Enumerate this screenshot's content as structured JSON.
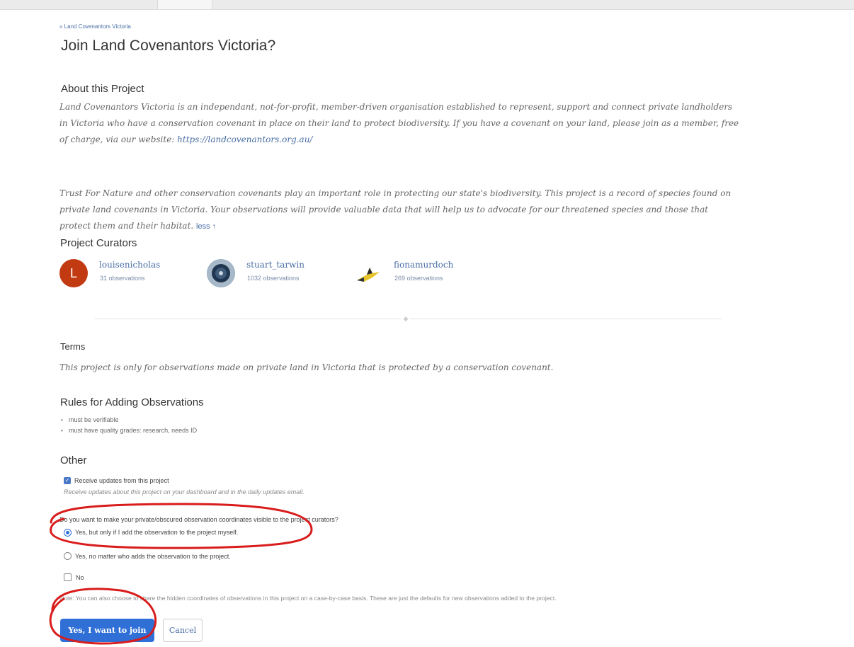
{
  "breadcrumb": "« Land Covenantors Victoria",
  "page_title": "Join Land Covenantors Victoria?",
  "about": {
    "heading": "About this Project",
    "para1": "Land Covenantors Victoria is an independant, not-for-profit, member-driven organisation established to represent, support and connect private landholders in Victoria who have a conservation covenant in place on their land to protect biodiversity. If you have a covenant on your land, please join as a member, free of charge, via our website: ",
    "para1_link": "https://landcovenantors.org.au/",
    "para2": "Trust For Nature and other conservation covenants play an important role in protecting our state's biodiversity. This project is a record of species found on private land covenants in Victoria. Your observations will provide valuable data that will help us to advocate for our threatened species and those that protect them and their habitat. ",
    "less_link": "less ↑"
  },
  "curators": {
    "heading": "Project Curators",
    "items": [
      {
        "name": "louisenicholas",
        "obs": "31 observations",
        "initial": "L",
        "color": "#c23a12"
      },
      {
        "name": "stuart_tarwin",
        "obs": "1032 observations",
        "color": "#2b4a6b"
      },
      {
        "name": "fionamurdoch",
        "obs": "269 observations",
        "color": "#e6c32a"
      }
    ]
  },
  "terms": {
    "heading": "Terms",
    "text": "This project is only for observations made on private land in Victoria that is protected by a conservation covenant."
  },
  "rules": {
    "heading": "Rules for Adding Observations",
    "items": [
      "must be verifiable",
      "must have quality grades: research, needs ID"
    ]
  },
  "other": {
    "heading": "Other",
    "receive_updates_label": "Receive updates from this project",
    "receive_updates_checked": true,
    "receive_updates_hint": "Receive updates about this project on your dashboard and in the daily updates email.",
    "question": "Do you want to make your private/obscured observation coordinates visible to the project curators?",
    "options": [
      {
        "label": "Yes, but only if I add the observation to the project myself.",
        "selected": true
      },
      {
        "label": "Yes, no matter who adds the observation to the project.",
        "selected": false
      },
      {
        "label": "No",
        "selected": false
      }
    ],
    "note": "Note: You can also choose to share the hidden coordinates of observations in this project on a case-by-case basis. These are just the defaults for new observations added to the project."
  },
  "buttons": {
    "join": "Yes, I want to join",
    "cancel": "Cancel"
  },
  "colors": {
    "link": "#4a6fa5",
    "primary": "#2f6fd6",
    "annotation": "#d91c1c"
  }
}
